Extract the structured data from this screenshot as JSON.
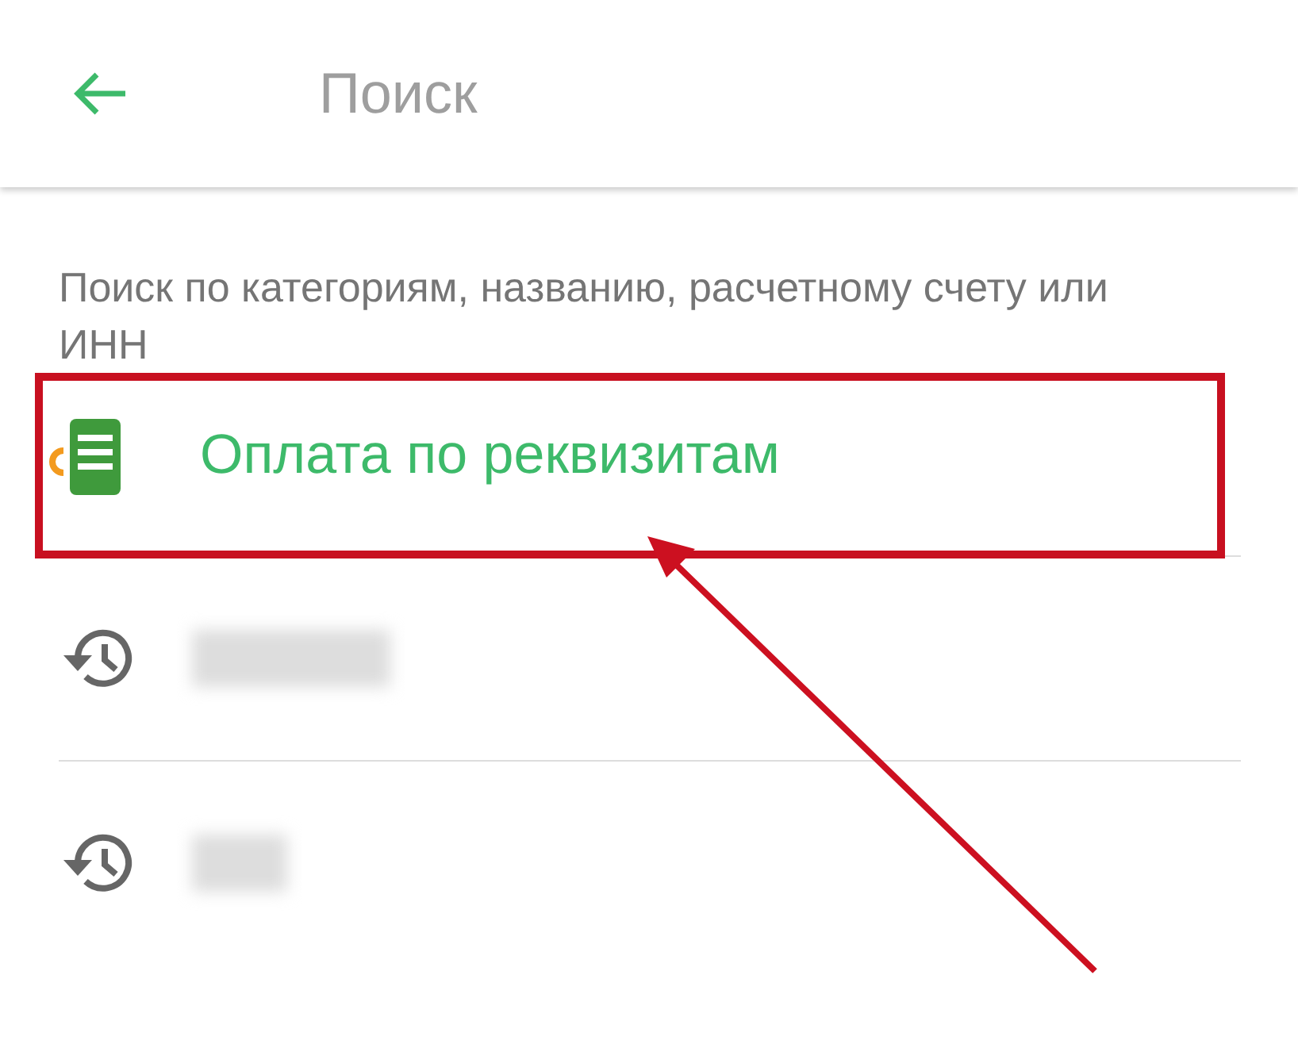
{
  "header": {
    "title": "Поиск"
  },
  "hint": "Поиск по категориям, названию, расчетному счету или ИНН",
  "items": [
    {
      "kind": "payment",
      "label": "Оплата по реквизитам",
      "highlighted": true
    },
    {
      "kind": "history-redacted"
    },
    {
      "kind": "history-redacted"
    }
  ]
}
